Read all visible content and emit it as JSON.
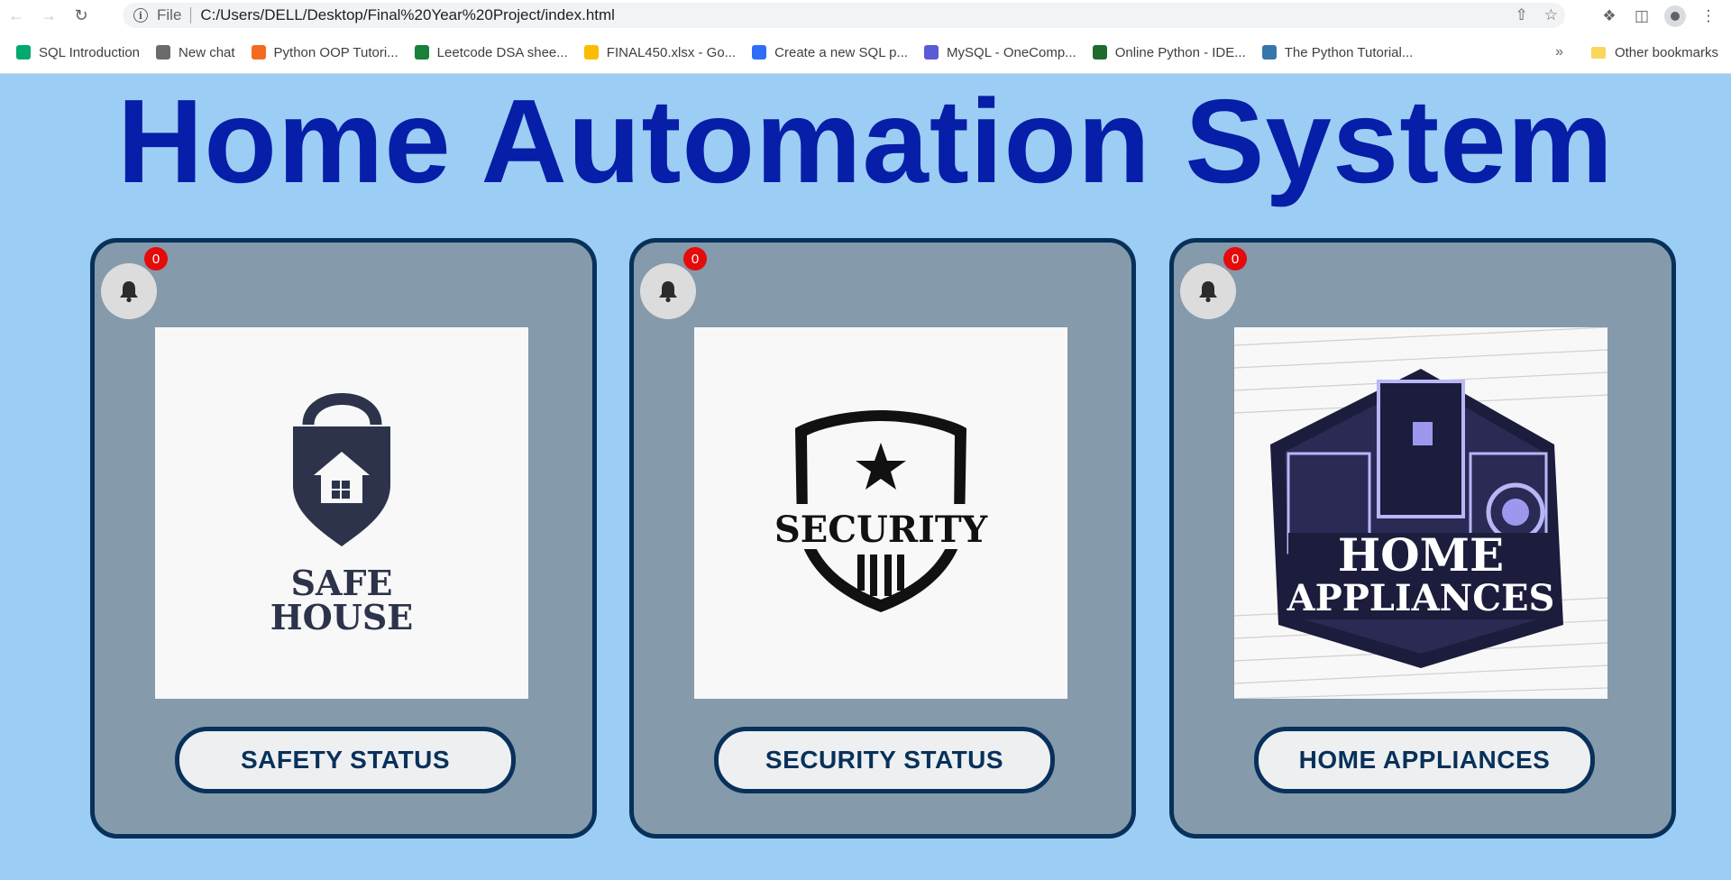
{
  "browser": {
    "url_scheme": "File",
    "url": "C:/Users/DELL/Desktop/Final%20Year%20Project/index.html",
    "bookmarks": [
      {
        "label": "SQL Introduction",
        "icon": "w3schools-icon",
        "color": "#04aa6d"
      },
      {
        "label": "New chat",
        "icon": "openai-icon",
        "color": "#6b6b6b"
      },
      {
        "label": "Python OOP Tutori...",
        "icon": "blogger-icon",
        "color": "#f26b21"
      },
      {
        "label": "Leetcode DSA shee...",
        "icon": "sheets-icon",
        "color": "#188038"
      },
      {
        "label": "FINAL450.xlsx - Go...",
        "icon": "drive-icon",
        "color": "#fbbc04"
      },
      {
        "label": "Create a new SQL p...",
        "icon": "dropbox-icon",
        "color": "#2f6df6"
      },
      {
        "label": "MySQL - OneComp...",
        "icon": "code-icon",
        "color": "#5b5bd6"
      },
      {
        "label": "Online Python - IDE...",
        "icon": "shield-icon",
        "color": "#1f6b2e"
      },
      {
        "label": "The Python Tutorial...",
        "icon": "python-icon",
        "color": "#3776ab"
      }
    ],
    "more": "»",
    "other_bookmarks": "Other bookmarks"
  },
  "page": {
    "title": "Home Automation System",
    "colors": {
      "background": "#9ccdf4",
      "title": "#061ea8",
      "card": "#859aab",
      "border": "#08315a",
      "badge": "#e60b0b"
    }
  },
  "cards": [
    {
      "badge": "0",
      "button": "SAFETY STATUS",
      "logo_line1": "SAFE",
      "logo_line2": "HOUSE"
    },
    {
      "badge": "0",
      "button": "SECURITY STATUS",
      "logo_text": "SECURITY"
    },
    {
      "badge": "0",
      "button": "HOME APPLIANCES",
      "logo_line1": "HOME",
      "logo_line2": "APPLIANCES"
    }
  ]
}
